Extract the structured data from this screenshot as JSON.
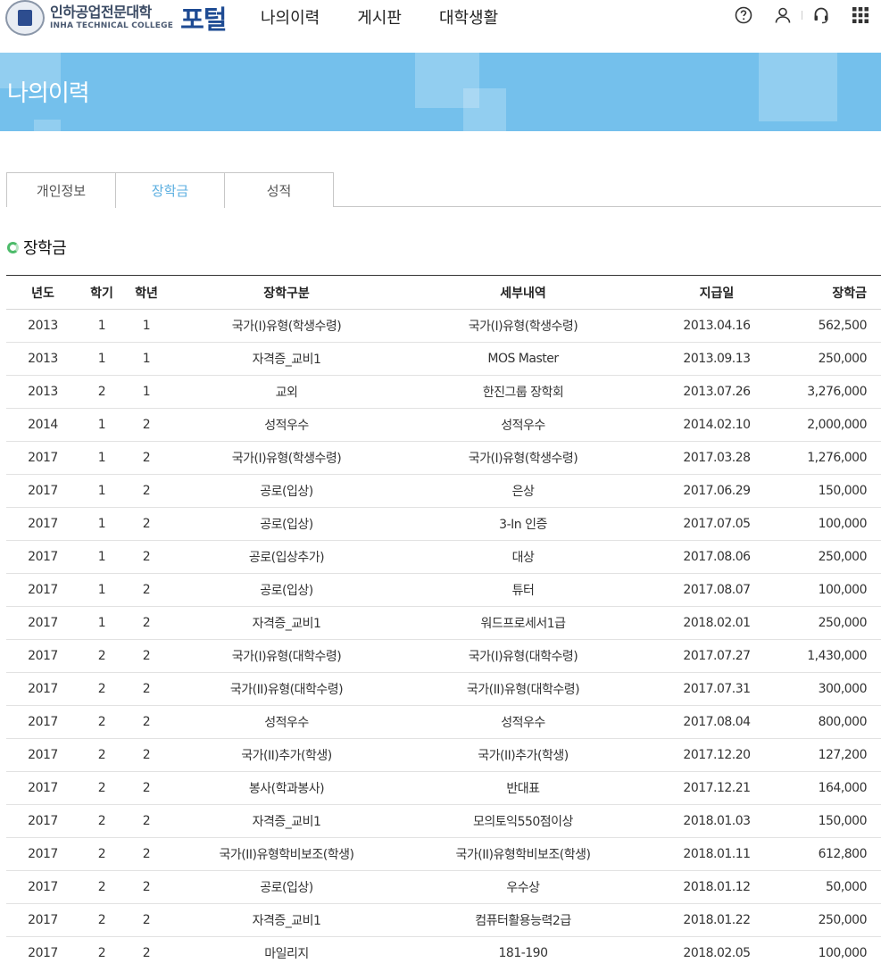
{
  "header": {
    "logo_kr": "인하공업전문대학",
    "logo_en": "INHA TECHNICAL COLLEGE",
    "portal": "포털",
    "nav": [
      "나의이력",
      "게시판",
      "대학생활"
    ],
    "util_icons": [
      "help-icon",
      "user-icon",
      "headset-icon",
      "grid-menu-icon"
    ]
  },
  "banner": {
    "title": "나의이력"
  },
  "tabs": [
    {
      "label": "개인정보",
      "active": false
    },
    {
      "label": "장학금",
      "active": true
    },
    {
      "label": "성적",
      "active": false
    }
  ],
  "section": {
    "title": "장학금"
  },
  "table": {
    "headers": [
      "년도",
      "학기",
      "학년",
      "장학구분",
      "세부내역",
      "지급일",
      "장학금"
    ],
    "rows": [
      [
        "2013",
        "1",
        "1",
        "국가(I)유형(학생수령)",
        "국가(I)유형(학생수령)",
        "2013.04.16",
        "562,500"
      ],
      [
        "2013",
        "1",
        "1",
        "자격증_교비1",
        "MOS Master",
        "2013.09.13",
        "250,000"
      ],
      [
        "2013",
        "2",
        "1",
        "교외",
        "한진그룹 장학회",
        "2013.07.26",
        "3,276,000"
      ],
      [
        "2014",
        "1",
        "2",
        "성적우수",
        "성적우수",
        "2014.02.10",
        "2,000,000"
      ],
      [
        "2017",
        "1",
        "2",
        "국가(I)유형(학생수령)",
        "국가(I)유형(학생수령)",
        "2017.03.28",
        "1,276,000"
      ],
      [
        "2017",
        "1",
        "2",
        "공로(입상)",
        "은상",
        "2017.06.29",
        "150,000"
      ],
      [
        "2017",
        "1",
        "2",
        "공로(입상)",
        "3-In 인증",
        "2017.07.05",
        "100,000"
      ],
      [
        "2017",
        "1",
        "2",
        "공로(입상추가)",
        "대상",
        "2017.08.06",
        "250,000"
      ],
      [
        "2017",
        "1",
        "2",
        "공로(입상)",
        "튜터",
        "2017.08.07",
        "100,000"
      ],
      [
        "2017",
        "1",
        "2",
        "자격증_교비1",
        "워드프로세서1급",
        "2018.02.01",
        "250,000"
      ],
      [
        "2017",
        "2",
        "2",
        "국가(I)유형(대학수령)",
        "국가(I)유형(대학수령)",
        "2017.07.27",
        "1,430,000"
      ],
      [
        "2017",
        "2",
        "2",
        "국가(II)유형(대학수령)",
        "국가(II)유형(대학수령)",
        "2017.07.31",
        "300,000"
      ],
      [
        "2017",
        "2",
        "2",
        "성적우수",
        "성적우수",
        "2017.08.04",
        "800,000"
      ],
      [
        "2017",
        "2",
        "2",
        "국가(II)추가(학생)",
        "국가(II)추가(학생)",
        "2017.12.20",
        "127,200"
      ],
      [
        "2017",
        "2",
        "2",
        "봉사(학과봉사)",
        "반대표",
        "2017.12.21",
        "164,000"
      ],
      [
        "2017",
        "2",
        "2",
        "자격증_교비1",
        "모의토익550점이상",
        "2018.01.03",
        "150,000"
      ],
      [
        "2017",
        "2",
        "2",
        "국가(II)유형학비보조(학생)",
        "국가(II)유형학비보조(학생)",
        "2018.01.11",
        "612,800"
      ],
      [
        "2017",
        "2",
        "2",
        "공로(입상)",
        "우수상",
        "2018.01.12",
        "50,000"
      ],
      [
        "2017",
        "2",
        "2",
        "자격증_교비1",
        "컴퓨터활용능력2급",
        "2018.01.22",
        "250,000"
      ],
      [
        "2017",
        "2",
        "2",
        "마일리지",
        "181-190",
        "2018.02.05",
        "100,000"
      ]
    ]
  },
  "colors": {
    "banner": "#74c0ec",
    "active_tab": "#5aaee0",
    "ring": "#4dbb6a",
    "portal": "#1e4b93"
  }
}
